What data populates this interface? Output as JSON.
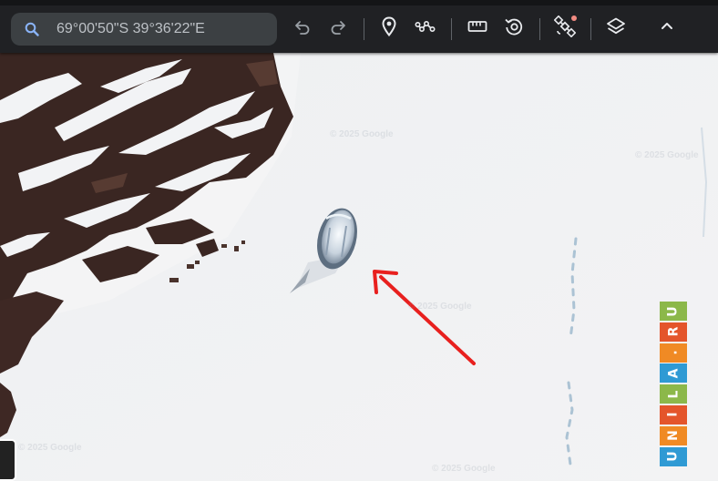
{
  "search": {
    "value": "69°00'50\"S 39°36'22\"E",
    "placeholder": ""
  },
  "toolbar": {
    "buttons": [
      {
        "name": "undo-button",
        "icon": "undo-icon"
      },
      {
        "name": "redo-button",
        "icon": "redo-icon"
      },
      {
        "name": "add-placemark-button",
        "icon": "placemark-icon"
      },
      {
        "name": "draw-path-button",
        "icon": "path-icon"
      },
      {
        "name": "measure-button",
        "icon": "ruler-icon"
      },
      {
        "name": "historical-imagery-button",
        "icon": "history-icon"
      },
      {
        "name": "satellite-button",
        "icon": "satellite-icon"
      },
      {
        "name": "map-style-button",
        "icon": "layers-icon"
      },
      {
        "name": "collapse-toolbar-button",
        "icon": "chevron-up-icon"
      }
    ]
  },
  "map": {
    "watermarks": [
      "© 2025 Google",
      "© 2025 Google",
      "© 2025 Google",
      "© 2025 Google",
      "© 2025 Google"
    ]
  },
  "brand_badge": {
    "letters": [
      "U",
      "N",
      "I",
      "L",
      "A",
      ".",
      "R",
      "U"
    ],
    "colors": [
      "#2f9ad4",
      "#f08a24",
      "#e4552b",
      "#8cb84a",
      "#2f9ad4",
      "#f08a24",
      "#e4552b",
      "#8cb84a"
    ]
  },
  "colors": {
    "toolbar_bg": "#202124",
    "search_bg": "#3c4043",
    "icon": "#e8eaed",
    "snow": "#f1f2f3",
    "rock": "#3a2622",
    "arrow": "#e8201e",
    "notification_dot": "#f28b82"
  }
}
